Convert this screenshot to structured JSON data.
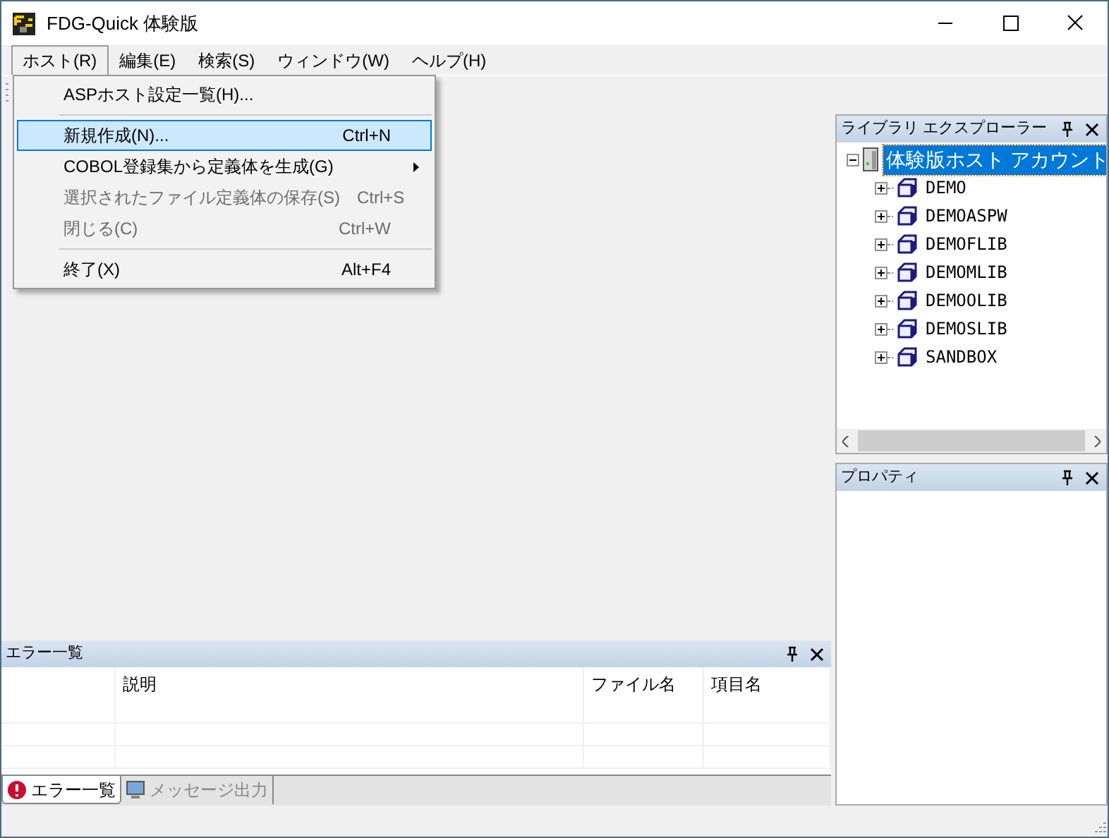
{
  "window": {
    "title": "FDG-Quick 体験版"
  },
  "menubar": [
    {
      "label": "ホスト(R)",
      "selected": true
    },
    {
      "label": "編集(E)",
      "selected": false
    },
    {
      "label": "検索(S)",
      "selected": false
    },
    {
      "label": "ウィンドウ(W)",
      "selected": false
    },
    {
      "label": "ヘルプ(H)",
      "selected": false
    }
  ],
  "menu": [
    {
      "kind": "item",
      "label": "ASPホスト設定一覧(H)...",
      "disabled": false,
      "selected": false,
      "submenu": false
    },
    {
      "kind": "separator"
    },
    {
      "kind": "item",
      "label": "新規作成(N)...",
      "shortcut": "Ctrl+N",
      "disabled": false,
      "selected": true,
      "submenu": false
    },
    {
      "kind": "item",
      "label": "COBOL登録集から定義体を生成(G)",
      "disabled": false,
      "selected": false,
      "submenu": true
    },
    {
      "kind": "item",
      "label": "選択されたファイル定義体の保存(S)",
      "shortcut": "Ctrl+S",
      "disabled": true,
      "selected": false,
      "submenu": false
    },
    {
      "kind": "item",
      "label": "閉じる(C)",
      "shortcut": "Ctrl+W",
      "disabled": true,
      "selected": false,
      "submenu": false
    },
    {
      "kind": "separator"
    },
    {
      "kind": "item",
      "label": "終了(X)",
      "shortcut": "Alt+F4",
      "disabled": false,
      "selected": false,
      "submenu": false
    }
  ],
  "library_explorer": {
    "title": "ライブラリ エクスプローラー",
    "tree": [
      {
        "label": "体験版ホスト アカウント",
        "selected": true,
        "expanded": true,
        "children": [
          {
            "label": "DEMO",
            "selected": false,
            "expanded": false
          },
          {
            "label": "DEMOASPW",
            "selected": false,
            "expanded": false
          },
          {
            "label": "DEMOFLIB",
            "selected": false,
            "expanded": false
          },
          {
            "label": "DEMOMLIB",
            "selected": false,
            "expanded": false
          },
          {
            "label": "DEMOOLIB",
            "selected": false,
            "expanded": false
          },
          {
            "label": "DEMOSLIB",
            "selected": false,
            "expanded": false
          },
          {
            "label": "SANDBOX",
            "selected": false,
            "expanded": false
          }
        ]
      }
    ]
  },
  "properties": {
    "title": "プロパティ"
  },
  "error_panel": {
    "title": "エラー一覧",
    "columns": [
      "説明",
      "ファイル名",
      "項目名"
    ],
    "tabs": [
      {
        "label": "エラー一覧",
        "selected": true
      },
      {
        "label": "メッセージ出力",
        "selected": false
      }
    ]
  }
}
